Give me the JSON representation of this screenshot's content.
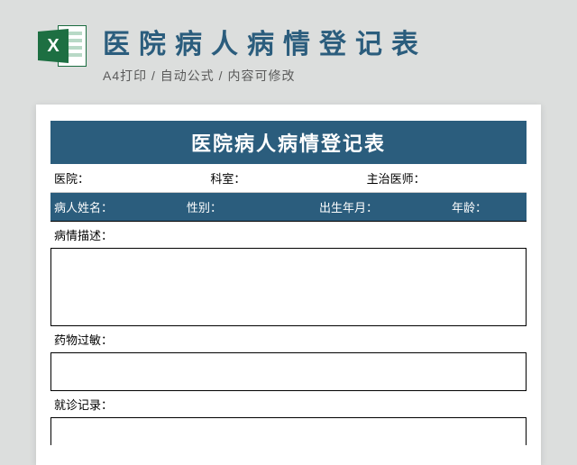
{
  "header": {
    "title": "医院病人病情登记表",
    "subtitle": "A4打印 / 自动公式 / 内容可修改",
    "icon_letter": "X"
  },
  "form": {
    "title": "医院病人病情登记表",
    "row1": {
      "hospital": "医院：",
      "department": "科室：",
      "doctor": "主治医师："
    },
    "row2": {
      "patient_name": "病人姓名：",
      "gender": "性别：",
      "birth": "出生年月：",
      "age": "年龄："
    },
    "sections": {
      "description": "病情描述：",
      "allergy": "药物过敏：",
      "visit_record": "就诊记录："
    }
  }
}
